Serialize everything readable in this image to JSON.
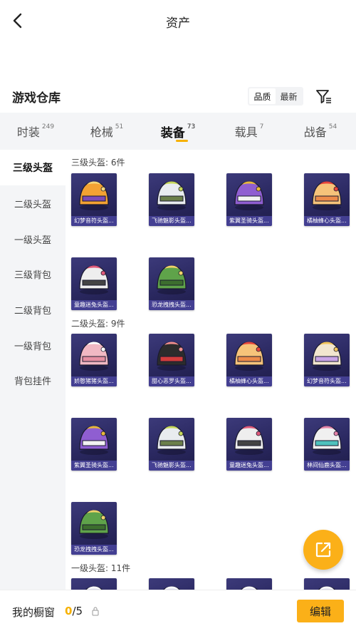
{
  "header": {
    "title": "资产"
  },
  "warehouse": {
    "title": "游戏仓库",
    "sort_options": [
      "品质",
      "最新"
    ],
    "active_sort": "最新"
  },
  "tabs": [
    {
      "label": "时装",
      "count": "249"
    },
    {
      "label": "枪械",
      "count": "51"
    },
    {
      "label": "装备",
      "count": "73"
    },
    {
      "label": "载具",
      "count": "7"
    },
    {
      "label": "战备",
      "count": "54"
    }
  ],
  "active_tab": "装备",
  "sidebar": {
    "items": [
      "三级头盔",
      "二级头盔",
      "一级头盔",
      "三级背包",
      "二级背包",
      "一级背包",
      "背包挂件"
    ],
    "active": "三级头盔"
  },
  "sections": [
    {
      "title": "三级头盔: 6件",
      "items": [
        {
          "label": "幻梦音符头盔...",
          "theme": "orange-purple"
        },
        {
          "label": "飞驰魅影头盔...",
          "theme": "white-green"
        },
        {
          "label": "紫翼圣骑头盔...",
          "theme": "purple-gold"
        },
        {
          "label": "橘柚蜂心头盔...",
          "theme": "peach-orange"
        },
        {
          "label": "童趣迷兔头盔...",
          "theme": "white-pink"
        },
        {
          "label": "恐龙拽拽头盔...",
          "theme": "green"
        }
      ]
    },
    {
      "title": "二级头盔: 9件",
      "items": [
        {
          "label": "娇憨猪猪头盔...",
          "theme": "pink"
        },
        {
          "label": "甜心恶罗头盔...",
          "theme": "black-red"
        },
        {
          "label": "橘柚蜂心头盔...",
          "theme": "peach-orange"
        },
        {
          "label": "幻梦音符头盔...",
          "theme": "cream-lilac"
        },
        {
          "label": "紫翼圣骑头盔...",
          "theme": "purple-gold"
        },
        {
          "label": "飞驰魅影头盔...",
          "theme": "white-green"
        },
        {
          "label": "童趣迷兔头盔...",
          "theme": "white-pink"
        },
        {
          "label": "林间仙鹿头盔...",
          "theme": "white-teal"
        },
        {
          "label": "恐龙拽拽头盔...",
          "theme": "green"
        }
      ]
    },
    {
      "title": "一级头盔: 11件",
      "items": []
    }
  ],
  "showcase": {
    "label": "我的橱窗",
    "current": "0",
    "total": "/5"
  },
  "actions": {
    "edit": "编辑"
  },
  "colors": {
    "accent": "#fbb018",
    "card_bg": "#2a2860",
    "card_label_bg": "#4641a0"
  },
  "icons": {
    "back": "chevron-left-icon",
    "filter": "filter-icon",
    "share": "share-external-icon",
    "lock": "lock-icon"
  }
}
